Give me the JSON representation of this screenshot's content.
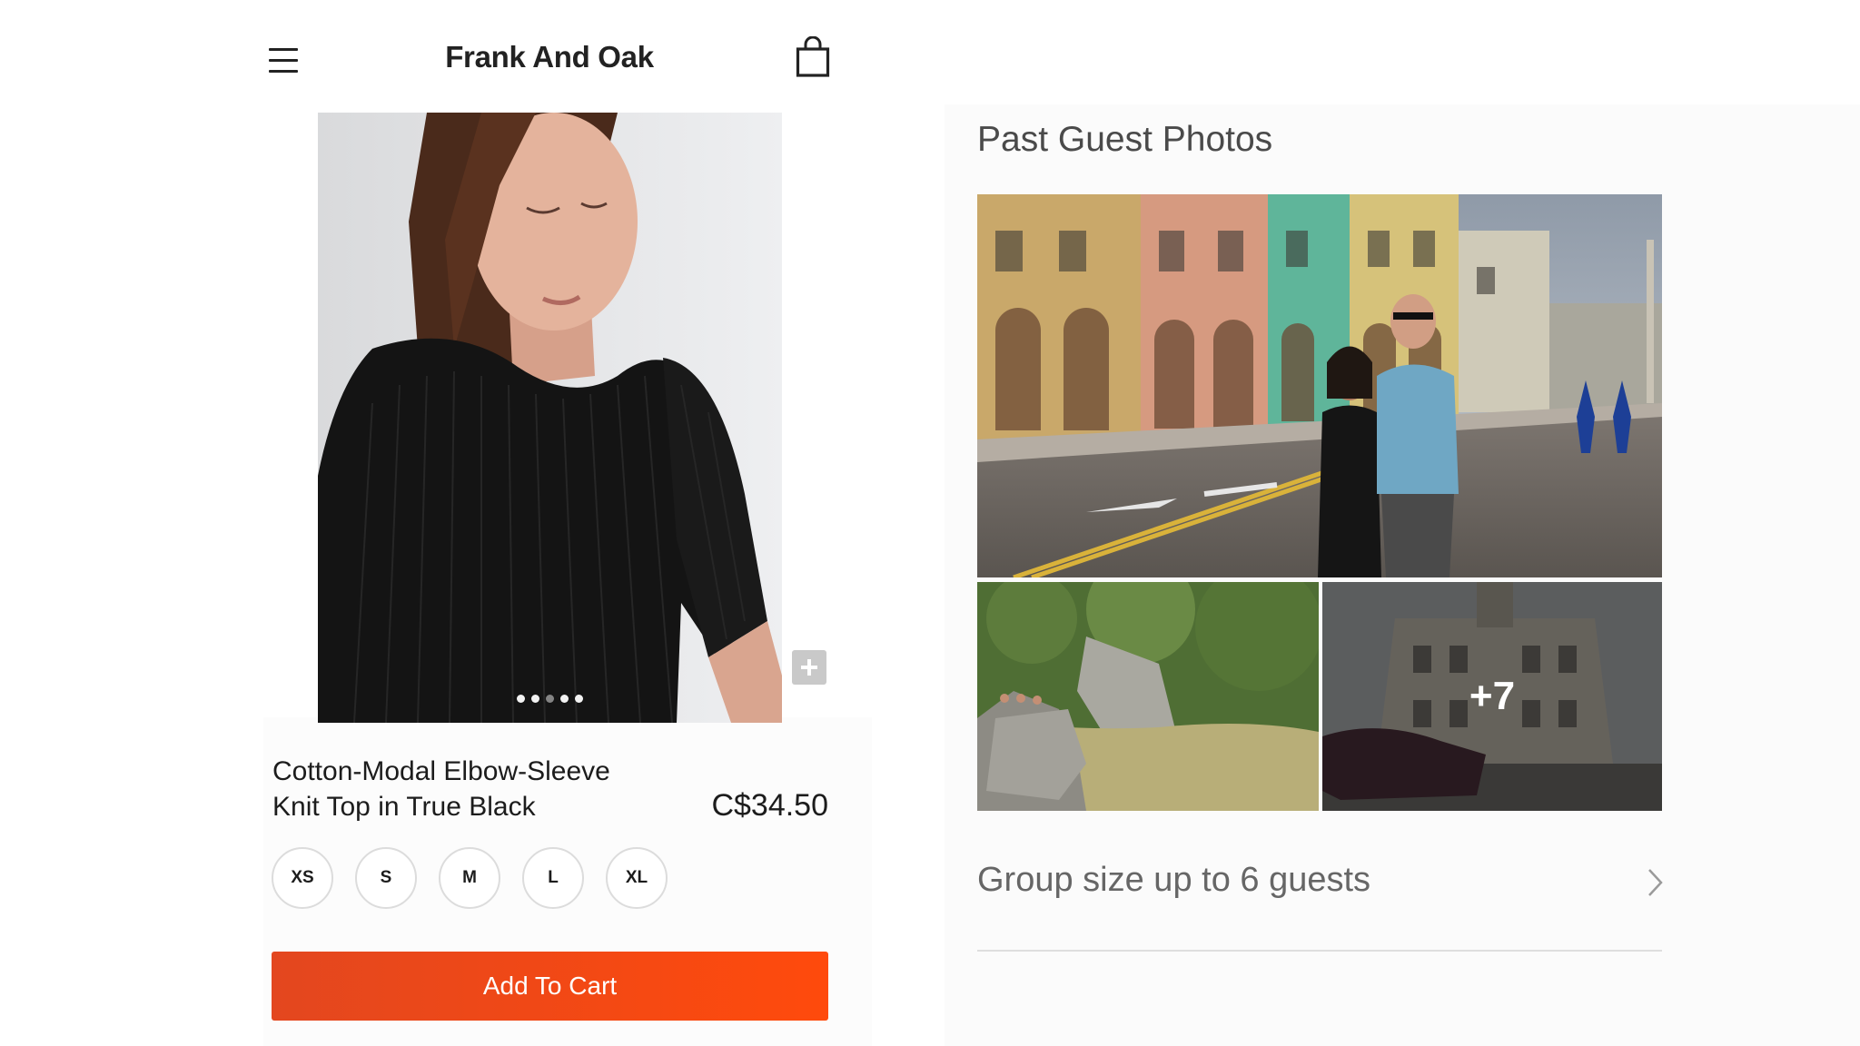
{
  "header": {
    "menu_icon": "hamburger-menu-icon",
    "brand": "Frank And Oak",
    "cart_icon": "shopping-bag-icon"
  },
  "product": {
    "image_count": 5,
    "active_image_index": 2,
    "name_line1": "Cotton-Modal Elbow-Sleeve",
    "name_line2": "Knit Top in True Black",
    "price": "C$34.50",
    "sizes": [
      "XS",
      "S",
      "M",
      "L",
      "XL"
    ],
    "add_to_cart_label": "Add To Cart",
    "zoom_icon": "plus-icon"
  },
  "guest_photos": {
    "title": "Past Guest Photos",
    "more_count": "+7"
  },
  "group": {
    "label": "Group size up to 6 guests",
    "chevron_icon": "chevron-right-icon"
  },
  "colors": {
    "accent_start": "#e3471f",
    "accent_end": "#ff4a0c",
    "text": "#222222"
  }
}
